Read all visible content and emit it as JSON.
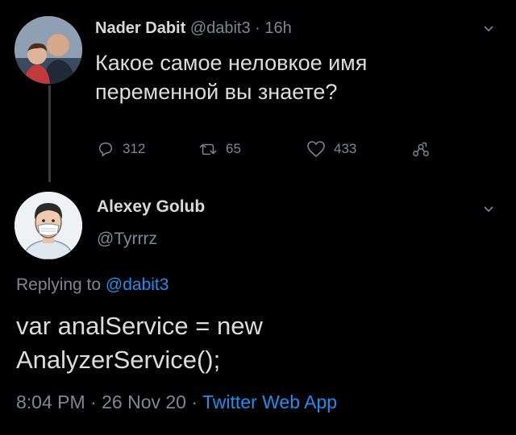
{
  "tweet": {
    "author_name": "Nader Dabit",
    "author_handle": "@dabit3",
    "separator": "·",
    "time_ago": "16h",
    "text": "Какое самое неловкое имя переменной вы знаете?",
    "replies": "312",
    "retweets": "65",
    "likes": "433"
  },
  "reply": {
    "author_name": "Alexey Golub",
    "author_handle": "@Tyrrrz",
    "replying_prefix": "Replying to",
    "replying_handle": "@dabit3",
    "text_line1": "var analService = new",
    "text_line2": "AnalyzerService();",
    "time": "8:04 PM",
    "separator": "·",
    "date": "26 Nov 20",
    "source": "Twitter Web App"
  },
  "icons": {
    "reply": "reply-icon",
    "retweet": "retweet-icon",
    "like": "heart-icon",
    "share": "share-icon",
    "more": "chevron-down-icon"
  },
  "colors": {
    "background": "#000000",
    "text": "#d9d9d9",
    "muted": "#7d8893",
    "link": "#1d8ff0"
  }
}
